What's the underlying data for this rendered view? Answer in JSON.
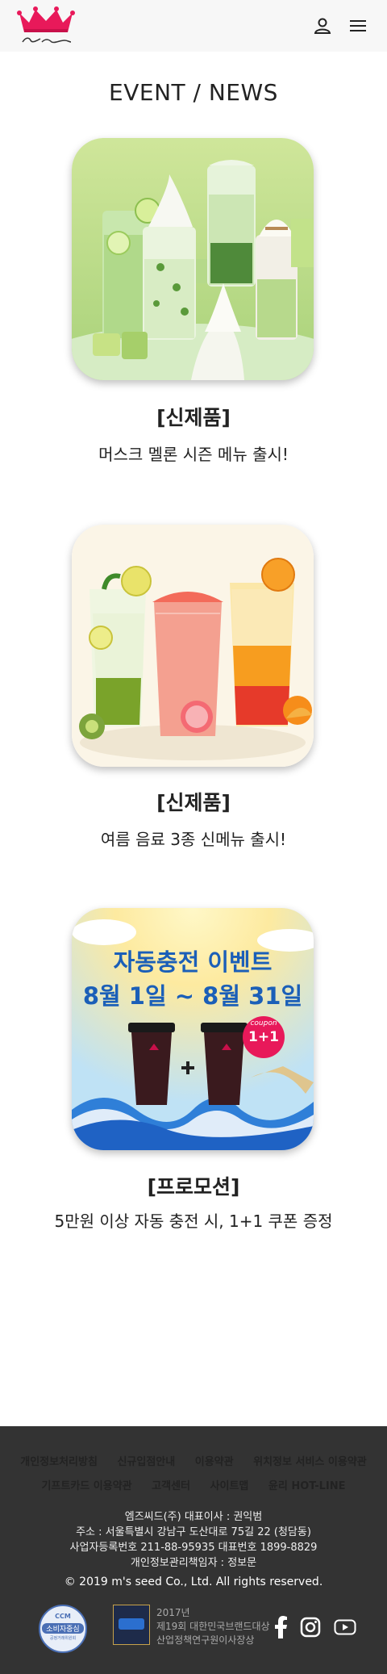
{
  "header": {
    "logo_text": "Paris Baguette",
    "icons": [
      "user-icon",
      "menu-icon"
    ]
  },
  "page_title": "EVENT / NEWS",
  "cards": [
    {
      "category": "[신제품]",
      "title": "머스크 멜론 시즌 메뉴 출시!"
    },
    {
      "category": "[신제품]",
      "title": "여름 음료 3종 신메뉴 출시!"
    },
    {
      "category": "[프로모션]",
      "title": "5만원 이상 자동 충전 시, 1+1 쿠폰 증정",
      "banner_line1": "자동충전 이벤트",
      "banner_line2": "8월 1일 ~ 8월 31일",
      "coupon_label": "coupon",
      "coupon_value": "1+1"
    }
  ],
  "footer": {
    "links_row1": [
      "개인정보처리방침",
      "신규입점안내",
      "이용약관",
      "위치정보 서비스 이용약관"
    ],
    "links_row2": [
      "기프트카드 이용약관",
      "고객센터",
      "사이트맵",
      "윤리 HOT-LINE"
    ],
    "company": "엠즈씨드(주) 대표이사 : 권익범",
    "address": "주소 : 서울특별시 강남구 도산대로 75길 22 (청담동)",
    "business": "사업자등록번호 211-88-95935 대표번호 1899-8829",
    "privacy_officer": "개인정보관리책임자 : 정보문",
    "copyright": "© 2019 m's seed Co., Ltd. All rights reserved.",
    "badge_ccm_top": "CCM",
    "badge_ccm_main": "소비자중심",
    "badge_ccm_sub": "공정거래위원회",
    "award_year": "2017년",
    "award_line1": "제19회 대한민국브랜드대상",
    "award_line2": "산업정책연구원이사장상",
    "social_icons": [
      "facebook-icon",
      "instagram-icon",
      "youtube-icon"
    ]
  }
}
